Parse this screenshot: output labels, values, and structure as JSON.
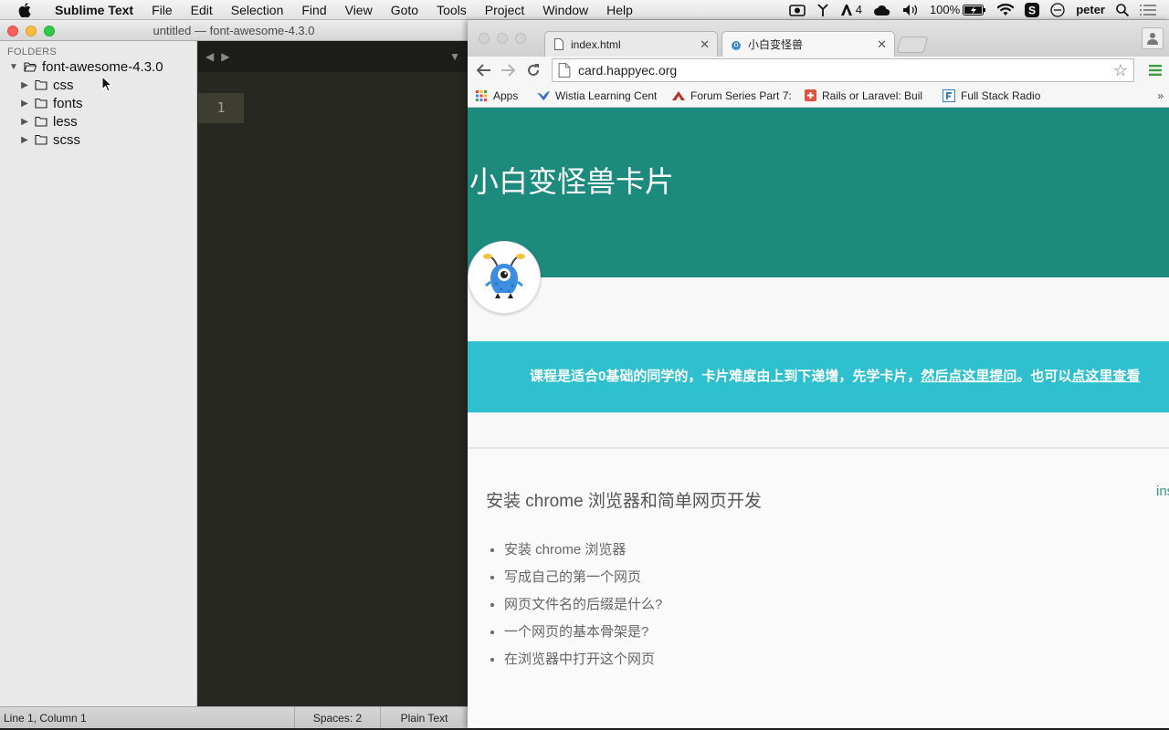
{
  "menubar": {
    "app_name": "Sublime Text",
    "items": [
      "File",
      "Edit",
      "Selection",
      "Find",
      "View",
      "Goto",
      "Tools",
      "Project",
      "Window",
      "Help"
    ],
    "status": {
      "adobe_count": "4",
      "battery": "100%",
      "user": "peter"
    }
  },
  "sublime": {
    "title": "untitled — font-awesome-4.3.0",
    "sidebar_header": "FOLDERS",
    "root_folder": "font-awesome-4.3.0",
    "folders": [
      "css",
      "fonts",
      "less",
      "scss"
    ],
    "line_number": "1",
    "status": {
      "position": "Line 1, Column 1",
      "spaces": "Spaces: 2",
      "syntax": "Plain Text"
    }
  },
  "chrome": {
    "tabs": [
      {
        "title": "index.html",
        "icon": "page-icon",
        "active": false
      },
      {
        "title": "小白变怪兽",
        "icon": "monster-favicon",
        "active": true
      }
    ],
    "url": "card.happyec.org",
    "bookmarks": [
      {
        "label": "Apps",
        "icon": "apps-grid-icon"
      },
      {
        "label": "Wistia Learning Cent",
        "icon": "wistia-icon"
      },
      {
        "label": "Forum Series Part 7:",
        "icon": "laracasts-icon"
      },
      {
        "label": "Rails or Laravel: Buil",
        "icon": "plus-box-icon"
      },
      {
        "label": "Full Stack Radio",
        "icon": "f-icon"
      }
    ],
    "bookmarks_more": "»"
  },
  "page": {
    "hero_title": "小白变怪兽卡片",
    "notice_text": "课程是适合0基础的同学的，卡片难度由上到下递增，先学卡片，",
    "notice_link1": "然后点这里提问",
    "notice_mid": "。也可以",
    "notice_link2": "点这里查看",
    "card_title": "安装 chrome 浏览器和简单网页开发",
    "card_side_link": "ins",
    "card_items": [
      "安装 chrome 浏览器",
      "写成自己的第一个网页",
      "网页文件名的后缀是什么?",
      "一个网页的基本骨架是?",
      "在浏览器中打开这个网页"
    ]
  },
  "colors": {
    "hero_bg": "#1d8a7e",
    "notice_bg": "#2ec0cf",
    "editor_bg": "#272822"
  }
}
